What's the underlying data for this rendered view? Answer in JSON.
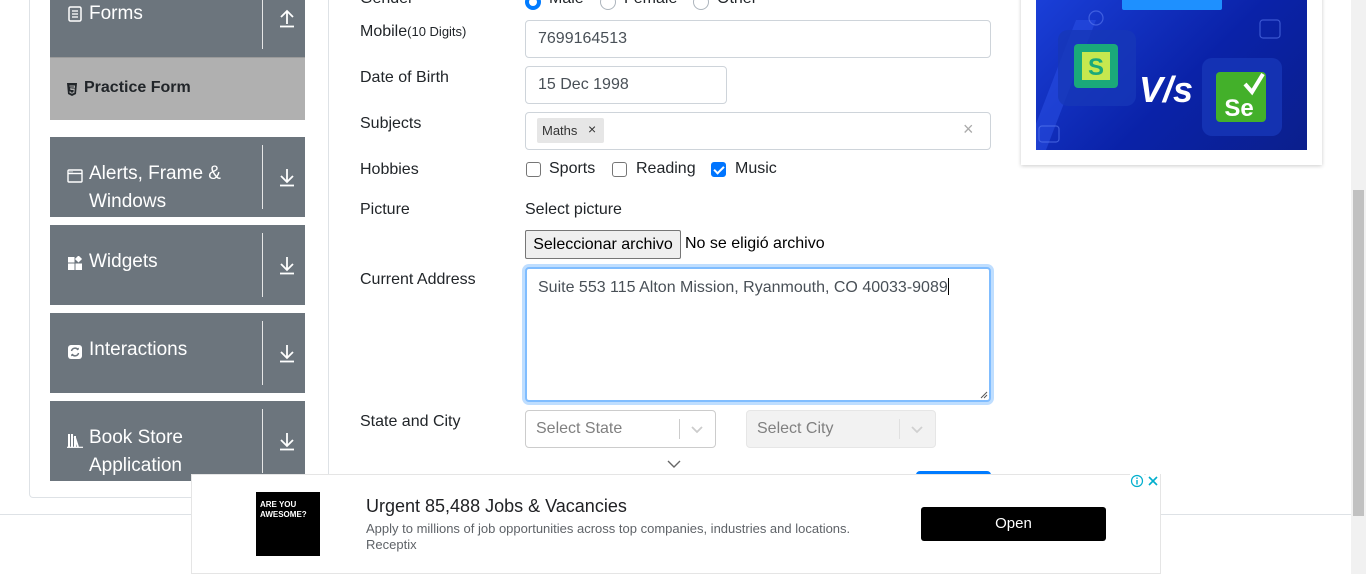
{
  "sidebar": {
    "forms_label": "Forms",
    "practice_form_label": "Practice Form",
    "alerts_label_line1": "Alerts, Frame &",
    "alerts_label_line2": "Windows",
    "widgets_label": "Widgets",
    "interactions_label": "Interactions",
    "bookstore_label_line1": "Book Store",
    "bookstore_label_line2": "Application"
  },
  "form": {
    "gender": {
      "label": "Gender",
      "options": [
        "Male",
        "Female",
        "Other"
      ],
      "selected": "Male"
    },
    "mobile": {
      "label": "Mobile",
      "hint": "(10 Digits)",
      "value": "7699164513"
    },
    "dob": {
      "label": "Date of Birth",
      "value": "15 Dec 1998"
    },
    "subjects": {
      "label": "Subjects",
      "chips": [
        "Maths"
      ],
      "chip_remove": "×",
      "clear": "×"
    },
    "hobbies": {
      "label": "Hobbies",
      "options": [
        {
          "label": "Sports",
          "checked": false
        },
        {
          "label": "Reading",
          "checked": false
        },
        {
          "label": "Music",
          "checked": true
        }
      ]
    },
    "picture": {
      "label": "Picture",
      "select_label": "Select picture",
      "button": "Seleccionar archivo",
      "status": "No se eligió archivo"
    },
    "address": {
      "label": "Current Address",
      "value": "Suite 553 115 Alton Mission, Ryanmouth, CO 40033-9089"
    },
    "state_city": {
      "label": "State and City",
      "state_placeholder": "Select State",
      "city_placeholder": "Select City"
    }
  },
  "ad_banner": {
    "logo_line1": "ARE YOU",
    "logo_line2": "AWESOME?",
    "title": "Urgent 85,488 Jobs & Vacancies",
    "description": "Apply to millions of job opportunities across top companies, industries and locations.",
    "source": "Receptix",
    "button": "Open"
  },
  "ad_image": {
    "left_logo": "S",
    "vs_text": "V/s",
    "right_logo": "Se"
  },
  "colors": {
    "sidebar_group": "#6c757d",
    "practice_active": "#b0b0b0",
    "primary": "#007bff",
    "checkbox_checked": "#0075ff",
    "ad_blue": "#1a3fd8",
    "selenium_green": "#43b02a"
  }
}
